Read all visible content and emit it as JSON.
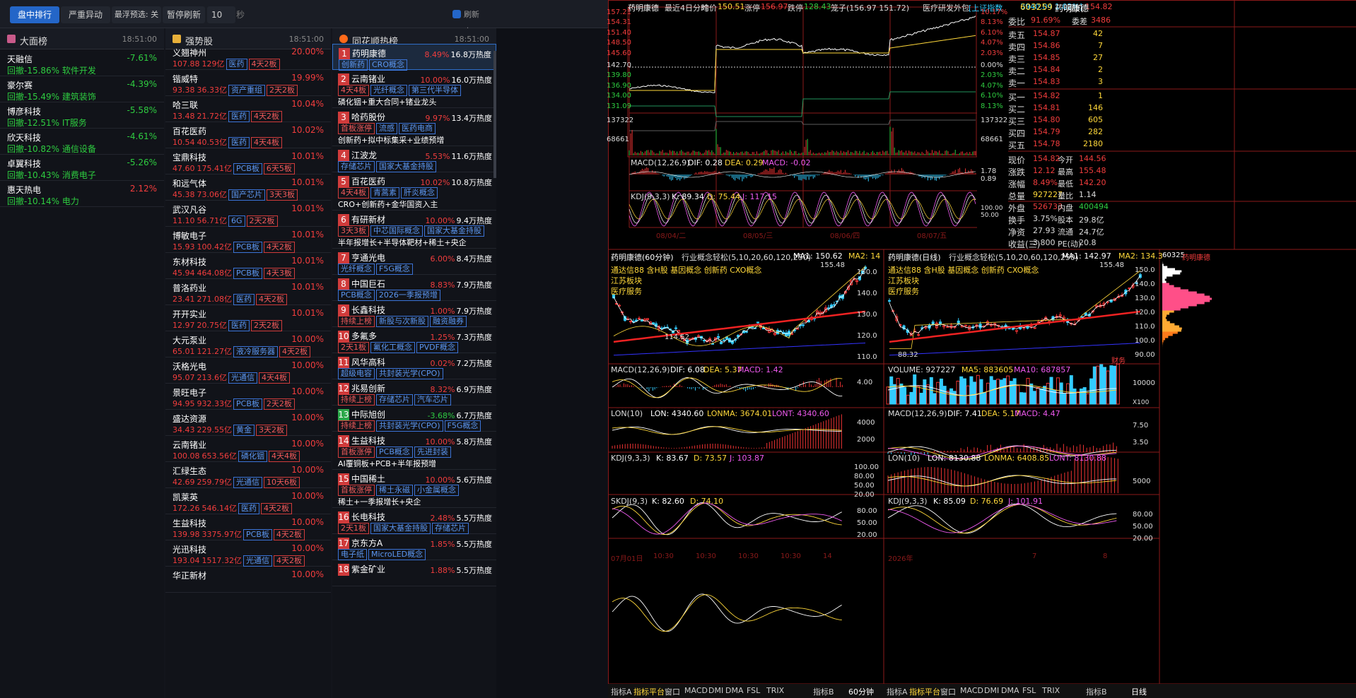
{
  "topbar": {
    "tabs": [
      "盘中排行",
      "严重异动"
    ],
    "preview": "最浮预选: 关",
    "pause": "暂停刷新",
    "count": "10",
    "sec": "秒",
    "refresh": "刷新中..."
  },
  "col1": {
    "title": "大面榜",
    "time": "18:51:00",
    "rows": [
      {
        "name": "天融信",
        "pct": "-7.61%",
        "sub": "回撤-15.86% 软件开发"
      },
      {
        "name": "豪尔赛",
        "pct": "-4.39%",
        "sub": "回撤-15.49% 建筑装饰"
      },
      {
        "name": "博彦科技",
        "pct": "-5.58%",
        "sub": "回撤-12.51% IT服务"
      },
      {
        "name": "欣天科技",
        "pct": "-4.61%",
        "sub": "回撤-10.82% 通信设备"
      },
      {
        "name": "卓翼科技",
        "pct": "-5.26%",
        "sub": "回撤-10.43% 消费电子"
      },
      {
        "name": "惠天热电",
        "pct": "2.12%",
        "sub": "回撤-10.14% 电力"
      }
    ]
  },
  "col2": {
    "title": "强势股",
    "time": "18:51:00",
    "rows": [
      {
        "name": "义翘神州",
        "pct": "20.00%",
        "price": "107.88",
        "cap": "129亿",
        "t1": "医药",
        "t2": "4天2板"
      },
      {
        "name": "锴威特",
        "pct": "19.99%",
        "price": "93.38",
        "cap": "36.33亿",
        "t1": "资产重组",
        "t2": "2天2板"
      },
      {
        "name": "哈三联",
        "pct": "10.04%",
        "price": "13.48",
        "cap": "21.72亿",
        "t1": "医药",
        "t2": "4天2板"
      },
      {
        "name": "百花医药",
        "pct": "10.02%",
        "price": "10.54",
        "cap": "40.53亿",
        "t1": "医药",
        "t2": "4天4板"
      },
      {
        "name": "宝鼎科技",
        "pct": "10.01%",
        "price": "47.60",
        "cap": "175.41亿",
        "t1": "PCB板",
        "t2": "6天5板"
      },
      {
        "name": "和远气体",
        "pct": "10.01%",
        "price": "45.38",
        "cap": "73.06亿",
        "t1": "国产芯片",
        "t2": "3天3板"
      },
      {
        "name": "武汉凡谷",
        "pct": "10.01%",
        "price": "11.10",
        "cap": "56.71亿",
        "t1": "6G",
        "t2": "2天2板"
      },
      {
        "name": "博敏电子",
        "pct": "10.01%",
        "price": "15.93",
        "cap": "100.42亿",
        "t1": "PCB板",
        "t2": "4天2板"
      },
      {
        "name": "东材科技",
        "pct": "10.01%",
        "price": "45.94",
        "cap": "464.08亿",
        "t1": "PCB板",
        "t2": "4天3板"
      },
      {
        "name": "普洛药业",
        "pct": "10.01%",
        "price": "23.41",
        "cap": "271.08亿",
        "t1": "医药",
        "t2": "4天2板"
      },
      {
        "name": "开开实业",
        "pct": "10.01%",
        "price": "12.97",
        "cap": "20.75亿",
        "t1": "医药",
        "t2": "2天2板"
      },
      {
        "name": "大元泵业",
        "pct": "10.00%",
        "price": "65.01",
        "cap": "121.27亿",
        "t1": "液冷服务器",
        "t2": "4天2板"
      },
      {
        "name": "沃格光电",
        "pct": "10.00%",
        "price": "95.07",
        "cap": "213.6亿",
        "t1": "光通信",
        "t2": "4天4板"
      },
      {
        "name": "景旺电子",
        "pct": "10.00%",
        "price": "94.95",
        "cap": "932.33亿",
        "t1": "PCB板",
        "t2": "2天2板"
      },
      {
        "name": "盛达资源",
        "pct": "10.00%",
        "price": "34.43",
        "cap": "229.55亿",
        "t1": "黄金",
        "t2": "3天2板"
      },
      {
        "name": "云南锗业",
        "pct": "10.00%",
        "price": "100.08",
        "cap": "653.56亿",
        "t1": "磷化铟",
        "t2": "4天4板"
      },
      {
        "name": "汇绿生态",
        "pct": "10.00%",
        "price": "42.69",
        "cap": "259.79亿",
        "t1": "光通信",
        "t2": "10天6板"
      },
      {
        "name": "凯莱英",
        "pct": "10.00%",
        "price": "172.26",
        "cap": "546.14亿",
        "t1": "医药",
        "t2": "4天2板"
      },
      {
        "name": "生益科技",
        "pct": "10.00%",
        "price": "139.98",
        "cap": "3375.97亿",
        "t1": "PCB板",
        "t2": "4天2板"
      },
      {
        "name": "光迅科技",
        "pct": "10.00%",
        "price": "193.04",
        "cap": "1517.32亿",
        "t1": "光通信",
        "t2": "4天2板"
      },
      {
        "name": "华正新材",
        "pct": "10.00%",
        "price": "",
        "cap": "",
        "t1": "",
        "t2": ""
      }
    ]
  },
  "col3": {
    "title": "同花顺热榜",
    "time": "18:51:00",
    "rows": [
      {
        "n": "1",
        "name": "药明康德",
        "pct": "8.49%",
        "heat": "16.8万热度",
        "tags": [
          [
            "创新药",
            "b"
          ],
          [
            "CRO概念",
            "b"
          ]
        ],
        "desc": ""
      },
      {
        "n": "2",
        "name": "云南锗业",
        "pct": "10.00%",
        "heat": "16.0万热度",
        "tags": [
          [
            "4天4板",
            "r"
          ],
          [
            "光纤概念",
            "b"
          ],
          [
            "第三代半导体",
            "b"
          ]
        ],
        "desc": "磷化铟+重大合同+锗业龙头"
      },
      {
        "n": "3",
        "name": "哈药股份",
        "pct": "9.97%",
        "heat": "13.4万热度",
        "tags": [
          [
            "首板涨停",
            "r"
          ],
          [
            "流感",
            "b"
          ],
          [
            "医药电商",
            "b"
          ]
        ],
        "desc": "创新药+拟中标集采+业绩预增"
      },
      {
        "n": "4",
        "name": "江波龙",
        "pct": "5.53%",
        "heat": "11.6万热度",
        "tags": [
          [
            "存储芯片",
            "b"
          ],
          [
            "国家大基金持股",
            "b"
          ]
        ],
        "desc": ""
      },
      {
        "n": "5",
        "name": "百花医药",
        "pct": "10.02%",
        "heat": "10.8万热度",
        "tags": [
          [
            "4天4板",
            "r"
          ],
          [
            "青蒿素",
            "b"
          ],
          [
            "肝炎概念",
            "b"
          ]
        ],
        "desc": "CRO+创新药+金华国资入主"
      },
      {
        "n": "6",
        "name": "有研新材",
        "pct": "10.00%",
        "heat": "9.4万热度",
        "tags": [
          [
            "3天3板",
            "r"
          ],
          [
            "中芯国际概念",
            "b"
          ],
          [
            "国家大基金持股",
            "b"
          ]
        ],
        "desc": "半年报增长+半导体靶材+稀土+央企"
      },
      {
        "n": "7",
        "name": "亨通光电",
        "pct": "6.00%",
        "heat": "8.4万热度",
        "tags": [
          [
            "光纤概念",
            "b"
          ],
          [
            "F5G概念",
            "b"
          ]
        ],
        "desc": ""
      },
      {
        "n": "8",
        "name": "中国巨石",
        "pct": "8.83%",
        "heat": "7.9万热度",
        "tags": [
          [
            "PCB概念",
            "b"
          ],
          [
            "2026一季报预增",
            "b"
          ]
        ],
        "desc": ""
      },
      {
        "n": "9",
        "name": "长鑫科技",
        "pct": "1.00%",
        "heat": "7.9万热度",
        "tags": [
          [
            "持续上榜",
            "r"
          ],
          [
            "新股与次新股",
            "b"
          ],
          [
            "融资融券",
            "b"
          ]
        ],
        "desc": ""
      },
      {
        "n": "10",
        "name": "多氟多",
        "pct": "1.25%",
        "heat": "7.3万热度",
        "tags": [
          [
            "2天1板",
            "r"
          ],
          [
            "氟化工概念",
            "b"
          ],
          [
            "PVDF概念",
            "b"
          ]
        ],
        "desc": ""
      },
      {
        "n": "11",
        "name": "风华高科",
        "pct": "0.02%",
        "heat": "7.2万热度",
        "tags": [
          [
            "超级电容",
            "b"
          ],
          [
            "共封装光学(CPO)",
            "b"
          ]
        ],
        "desc": ""
      },
      {
        "n": "12",
        "name": "兆易创新",
        "pct": "8.32%",
        "heat": "6.9万热度",
        "tags": [
          [
            "持续上榜",
            "r"
          ],
          [
            "存储芯片",
            "b"
          ],
          [
            "汽车芯片",
            "b"
          ]
        ],
        "desc": ""
      },
      {
        "n": "13",
        "name": "中际旭创",
        "pct": "-3.68%",
        "heat": "6.7万热度",
        "tags": [
          [
            "持续上榜",
            "r"
          ],
          [
            "共封装光学(CPO)",
            "b"
          ],
          [
            "F5G概念",
            "b"
          ]
        ],
        "desc": ""
      },
      {
        "n": "14",
        "name": "生益科技",
        "pct": "10.00%",
        "heat": "5.8万热度",
        "tags": [
          [
            "首板涨停",
            "r"
          ],
          [
            "PCB概念",
            "b"
          ],
          [
            "先进封装",
            "b"
          ]
        ],
        "desc": "AI覆铜板+PCB+半年报预增"
      },
      {
        "n": "15",
        "name": "中国稀土",
        "pct": "10.00%",
        "heat": "5.6万热度",
        "tags": [
          [
            "首板涨停",
            "r"
          ],
          [
            "稀土永磁",
            "b"
          ],
          [
            "小金属概念",
            "b"
          ]
        ],
        "desc": "稀土+一季报增长+央企"
      },
      {
        "n": "16",
        "name": "长电科技",
        "pct": "2.48%",
        "heat": "5.5万热度",
        "tags": [
          [
            "2天1板",
            "r"
          ],
          [
            "国家大基金持股",
            "b"
          ],
          [
            "存储芯片",
            "b"
          ]
        ],
        "desc": ""
      },
      {
        "n": "17",
        "name": "京东方A",
        "pct": "1.85%",
        "heat": "5.5万热度",
        "tags": [
          [
            "电子纸",
            "b"
          ],
          [
            "MicroLED概念",
            "b"
          ]
        ],
        "desc": ""
      },
      {
        "n": "18",
        "name": "紫金矿业",
        "pct": "1.88%",
        "heat": "5.5万热度",
        "tags": [],
        "desc": ""
      }
    ]
  },
  "top": {
    "name": "药明康德",
    "period": "最近4日分时",
    "avg": "均价",
    "avgv": "150.51",
    "up": "涨停",
    "upv": "156.97",
    "dn": "跌停",
    "dnv": "128.43",
    "sub": "笼子(156.97 151.72)",
    "idx": "医疗研发外包",
    "idx2": "[上证指数",
    "idxv": "3940.04 1.02%]",
    "now": "现价",
    "nowv": "154.82",
    "yl": [
      "157.21",
      "154.31",
      "151.40",
      "148.50",
      "145.60",
      "142.70",
      "139.80",
      "136.90",
      "134.00",
      "131.09",
      "137322",
      "68661"
    ],
    "yr": [
      "10.17%",
      "8.13%",
      "6.10%",
      "4.07%",
      "2.03%",
      "0.00%",
      "2.03%",
      "4.07%",
      "6.10%",
      "8.13%",
      "137322",
      "68661"
    ],
    "macd": "MACD(12,26,9)",
    "dif": "DIF: 0.28",
    "dea": "DEA: 0.29",
    "macdv": "MACD: -0.02",
    "mr": [
      "1.78",
      "0.89"
    ],
    "kdj": "KDJ(9,3,3)",
    "k": "K: 89.34",
    "d": "D: 75.44",
    "j": "J: 117.15",
    "kr": [
      "100.00",
      "50.00"
    ],
    "dates": [
      "08/04/二",
      "08/05/三",
      "08/06/四",
      "08/07/五"
    ]
  },
  "ob": {
    "code": "603259",
    "name": "药明康德",
    "webi": "委比",
    "webiv": "91.69%",
    "wecha": "委差",
    "wechav": "3486",
    "sells": [
      [
        "卖五",
        "154.87",
        "42"
      ],
      [
        "卖四",
        "154.86",
        "7"
      ],
      [
        "卖三",
        "154.85",
        "27"
      ],
      [
        "卖二",
        "154.84",
        "2"
      ],
      [
        "卖一",
        "154.83",
        "3"
      ]
    ],
    "buys": [
      [
        "买一",
        "154.82",
        "1"
      ],
      [
        "买二",
        "154.81",
        "146"
      ],
      [
        "买三",
        "154.80",
        "605"
      ],
      [
        "买四",
        "154.79",
        "282"
      ],
      [
        "买五",
        "154.78",
        "2180"
      ]
    ],
    "stats": [
      [
        "现价",
        "154.82",
        "今开",
        "144.56"
      ],
      [
        "涨跌",
        "12.12",
        "最高",
        "155.48"
      ],
      [
        "涨幅",
        "8.49%",
        "最低",
        "142.20"
      ],
      [
        "总量",
        "927227",
        "量比",
        "1.14"
      ],
      [
        "外盘",
        "526733",
        "内盘",
        "400494"
      ],
      [
        "换手",
        "3.75%",
        "股本",
        "29.8亿"
      ],
      [
        "净资",
        "27.93",
        "流通",
        "24.7亿"
      ],
      [
        "收益(三)",
        "3.800",
        "PE(动)",
        "20.8"
      ]
    ]
  },
  "k60": {
    "title": "药明康德(60分钟)",
    "ind": "行业概念轻松(5,10,20,60,120,250)",
    "ma1": "MA1: 150.62",
    "ma2": "MA2: 14",
    "notes": [
      "通达信88 含H股 基因概念 创新药 CXO概念",
      "江苏板块",
      "医疗服务"
    ],
    "hi": "155.48",
    "lo": "114.52",
    "yl": [
      "150.0",
      "140.0",
      "130.0",
      "120.0",
      "110.0"
    ],
    "macd": "MACD(12,26,9)",
    "dif": "DIF: 6.08",
    "dea": "DEA: 5.37",
    "macdv": "MACD: 1.42",
    "m4": "4.00",
    "lon": "LON(10)",
    "lonv": "LON: 4340.60",
    "lonma": "LONMA: 3674.01",
    "lont": "LONT: 4340.60",
    "l1": "4000",
    "l2": "2000",
    "kdj": "KDJ(9,3,3)",
    "k": "K: 83.67",
    "d": "D: 73.57",
    "j": "J: 103.87",
    "kl": [
      "100.00",
      "80.00",
      "50.00",
      "20.00"
    ],
    "skdj": "SKDJ(9,3)",
    "sk": "K: 82.60",
    "sd": "D: 74.10",
    "sl": [
      "80.00",
      "50.00",
      "20.00"
    ],
    "dates": [
      "07月01日",
      "10:30",
      "10:30",
      "10:30",
      "10:30",
      "14"
    ]
  },
  "kd": {
    "title": "药明康德(日线)",
    "ind": "行业概念轻松(5,10,20,60,120,250)",
    "ma1": "MA1: 142.97",
    "ma2": "MA2: 134.3",
    "notes": [
      "通达信88 含H股 基因概念 创新药 CXO概念",
      "江苏板块",
      "医疗服务"
    ],
    "hi": "155.48",
    "lo": "88.32",
    "cai": "财务",
    "yl": [
      "150.0",
      "140.0",
      "130.0",
      "120.0",
      "110.0",
      "100.0",
      "90.00"
    ],
    "vol": "VOLUME: 927227",
    "ma5": "MA5: 883605",
    "ma10": "MA10: 687857",
    "v1": "10000",
    "vx": "X100",
    "macd": "MACD(12,26,9)",
    "dif": "DIF: 7.41",
    "dea": "DEA: 5.17",
    "macdv": "MACD: 4.47",
    "m1": "7.50",
    "m2": "3.50",
    "lon": "LON(10)",
    "lonv": "LON: 8130.88",
    "lonma": "LONMA: 6408.85",
    "lont": "LONT: 8130.88",
    "l1": "5000",
    "kdj": "KDJ(9,3,3)",
    "k": "K: 85.09",
    "d": "D: 76.69",
    "j": "J: 101.91",
    "kl": [
      "80.00",
      "50.00",
      "20.00"
    ],
    "dates": [
      "2026年",
      "7",
      "8"
    ]
  },
  "prof": {
    "code": "60325",
    "name": "药明康德"
  },
  "bottom": {
    "left": [
      "指标A",
      "指标平台",
      "窗口",
      "MACD",
      "DMI",
      "DMA",
      "FSL",
      "TRIX"
    ],
    "mid": "指标B",
    "per1": "60分钟",
    "right": [
      "指标A",
      "指标平台",
      "窗口",
      "MACD",
      "DMI",
      "DMA",
      "FSL",
      "TRIX"
    ],
    "mid2": "指标B",
    "per2": "日线"
  }
}
